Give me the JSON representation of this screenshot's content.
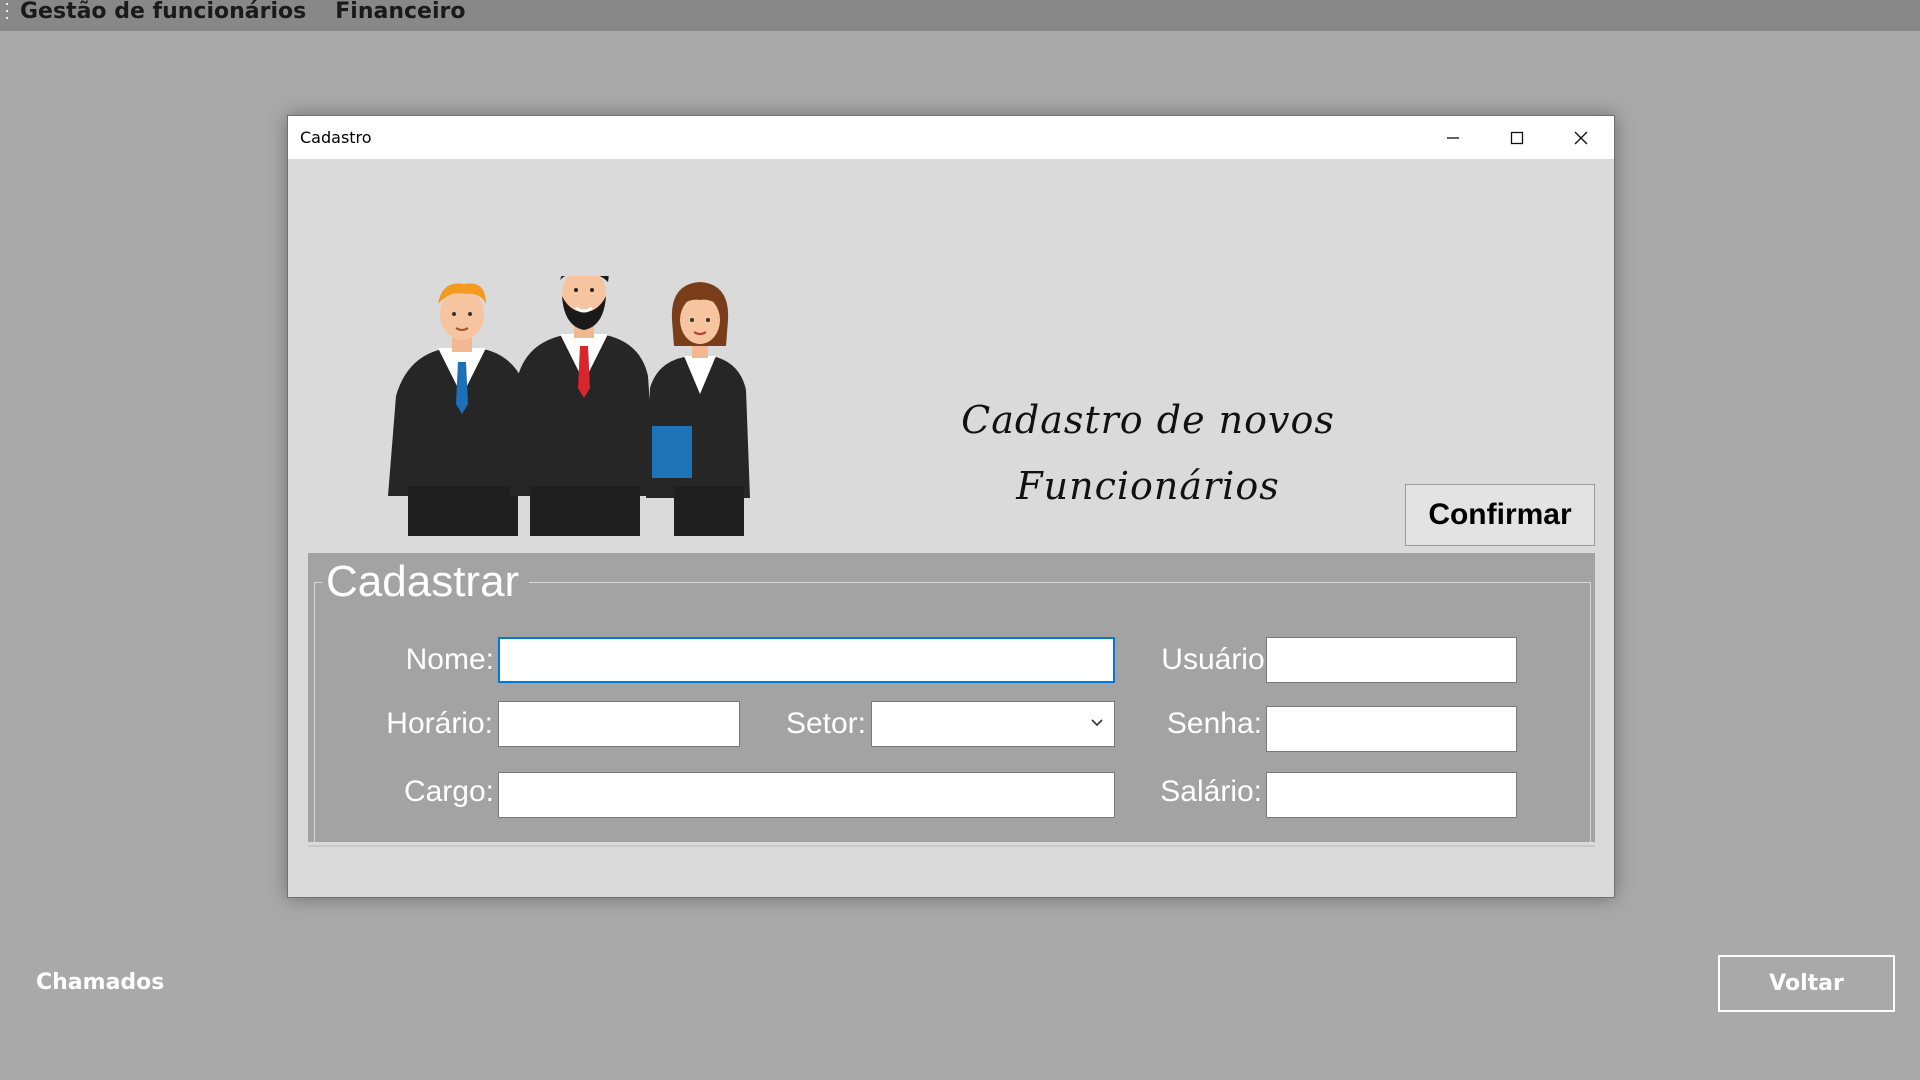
{
  "menubar": {
    "items": [
      "Gestão de funcionários",
      "Financeiro"
    ]
  },
  "window": {
    "title": "Cadastro",
    "headline_line1": "Cadastro de novos",
    "headline_line2": "Funcionários",
    "confirm_label": "Confirmar"
  },
  "group": {
    "title": "Cadastrar",
    "labels": {
      "nome": "Nome:",
      "usuario": "Usuário:",
      "horario": "Horário:",
      "setor": "Setor:",
      "senha": "Senha:",
      "cargo": "Cargo:",
      "salario": "Salário:"
    },
    "values": {
      "nome": "",
      "usuario": "",
      "horario": "",
      "setor": "",
      "senha": "",
      "cargo": "",
      "salario": ""
    }
  },
  "footer": {
    "chamados_label": "Chamados",
    "voltar_label": "Voltar"
  },
  "colors": {
    "background": "#a9a9a9",
    "menubar": "#888888",
    "panel": "#a3a3a3",
    "focus": "#0078d7"
  },
  "icons": [
    "grip-icon",
    "minimize-icon",
    "maximize-icon",
    "close-icon",
    "chevron-down-icon"
  ]
}
